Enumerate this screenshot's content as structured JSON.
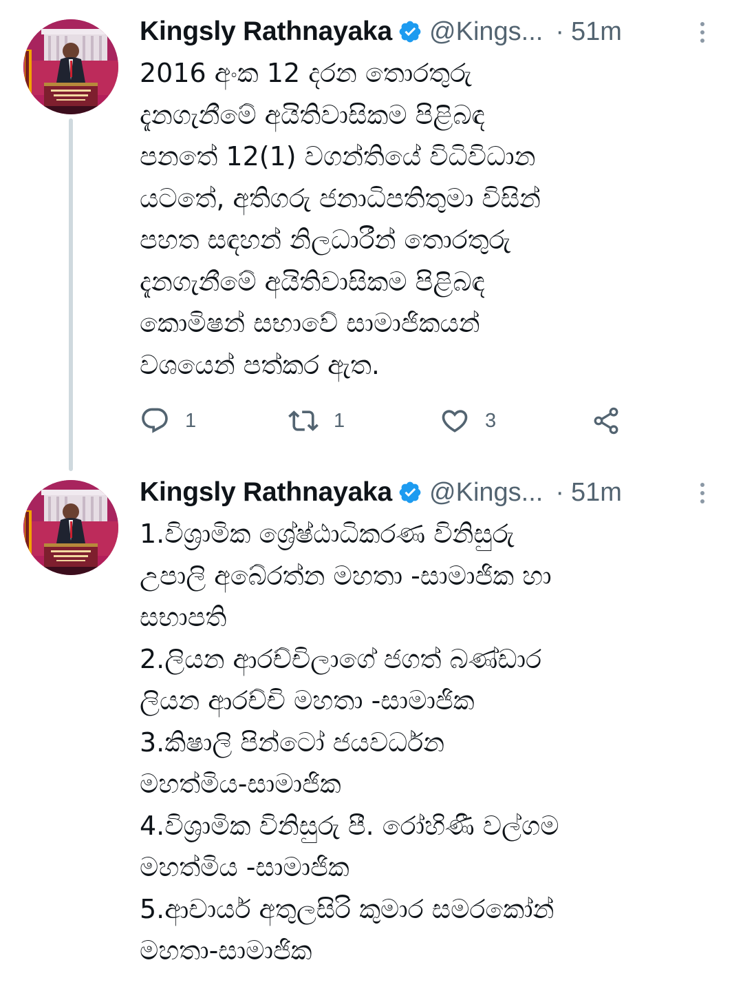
{
  "tweets": [
    {
      "author": {
        "name": "Kingsly Rathnayaka",
        "handle": "@Kings...",
        "separator": "·",
        "time": "51m",
        "avatar_icon": "presidential-media-centre-avatar",
        "verified_icon": "verified-badge-icon"
      },
      "lines": [
        "2016 අංක 12 දරන තොරතුරු",
        "දැනගැනීමේ අයිතිවාසිකම පිළිබඳ",
        "පනතේ 12(1) වගන්තියේ විධිවිධාන",
        "යටතේ, අතිගරු ජනාධිපතිතුමා විසින්",
        "පහත සඳහන් නිලධාරීන් තොරතුරු",
        "දැනගැනීමේ අයිතිවාසිකම පිළිබඳ",
        "කොමිෂන් සභාවේ සාමාජිකයන්",
        "වශයෙන් පත්කර ඇත."
      ],
      "actions": {
        "reply_count": "1",
        "retweet_count": "1",
        "like_count": "3"
      }
    },
    {
      "author": {
        "name": "Kingsly Rathnayaka",
        "handle": "@Kings...",
        "separator": "·",
        "time": "51m",
        "avatar_icon": "presidential-media-centre-avatar",
        "verified_icon": "verified-badge-icon"
      },
      "lines": [
        "1.විශ්‍රාමික ශ්‍රේෂ්ඨාධිකරණ විනිසුරු",
        "උපාලි අබේරත්න මහතා -සාමාජික හා",
        "සභාපති",
        "2.ලියන ආරච්චිලාගේ ජගත් බණ්ඩාර",
        "ලියන ආරච්චි මහතා -සාමාජික",
        "3.කිෂාලි පින්ටෝ ජයවර්ධන",
        "මහත්මිය-සාමාජික",
        "4.විශ්‍රාමික විනිසුරු පී. රෝහිණී වල්ගම",
        "මහත්මිය -සාමාජික",
        "5.ආචාර්ය අතුලසිරි කුමාර සමරකෝන්",
        "මහතා-සාමාජික"
      ]
    }
  ],
  "colors": {
    "text": "#0f1419",
    "secondary": "#536471",
    "verified": "#1d9bf0",
    "thread_line": "#cfd9de"
  }
}
